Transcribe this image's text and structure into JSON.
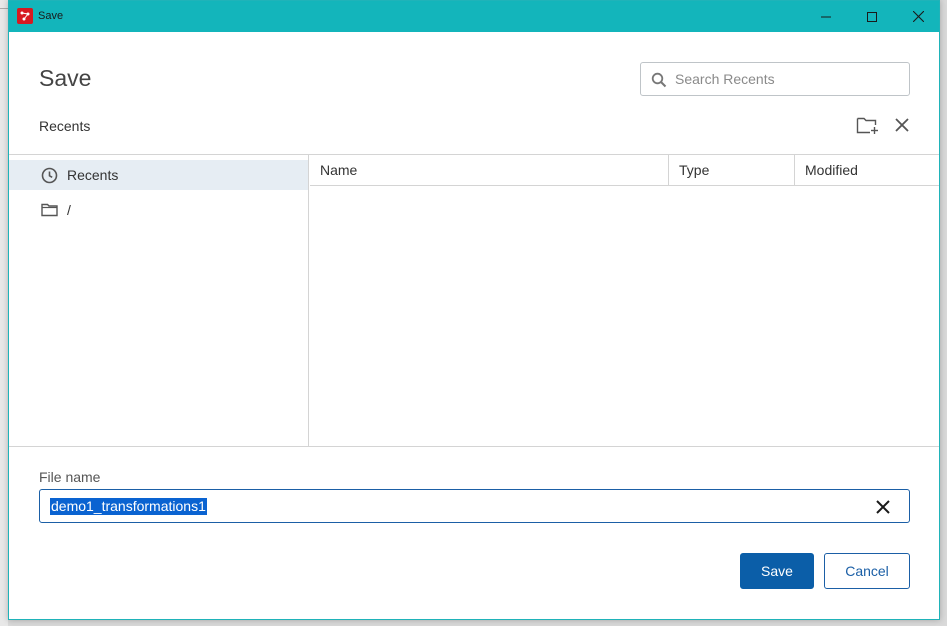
{
  "window": {
    "title": "Save",
    "titlebar_color": "#13b5bb",
    "icon": "app-logo-icon",
    "controls": [
      "minimize-icon",
      "maximize-icon",
      "close-icon"
    ]
  },
  "dialog": {
    "title": "Save",
    "breadcrumb": "Recents",
    "search": {
      "placeholder": "Search Recents",
      "value": ""
    },
    "toolbar": [
      "new-folder-icon",
      "close-icon"
    ]
  },
  "tree": {
    "items": [
      {
        "label": "Recents",
        "icon": "clock-icon",
        "selected": true
      },
      {
        "label": "/",
        "icon": "folder-icon",
        "selected": false
      }
    ]
  },
  "files": {
    "columns": [
      "Name",
      "Type",
      "Modified"
    ],
    "rows": []
  },
  "file_name": {
    "label": "File name",
    "value": "demo1_transformations1"
  },
  "actions": {
    "save_label": "Save",
    "cancel_label": "Cancel",
    "primary_color": "#0b5ea8"
  }
}
